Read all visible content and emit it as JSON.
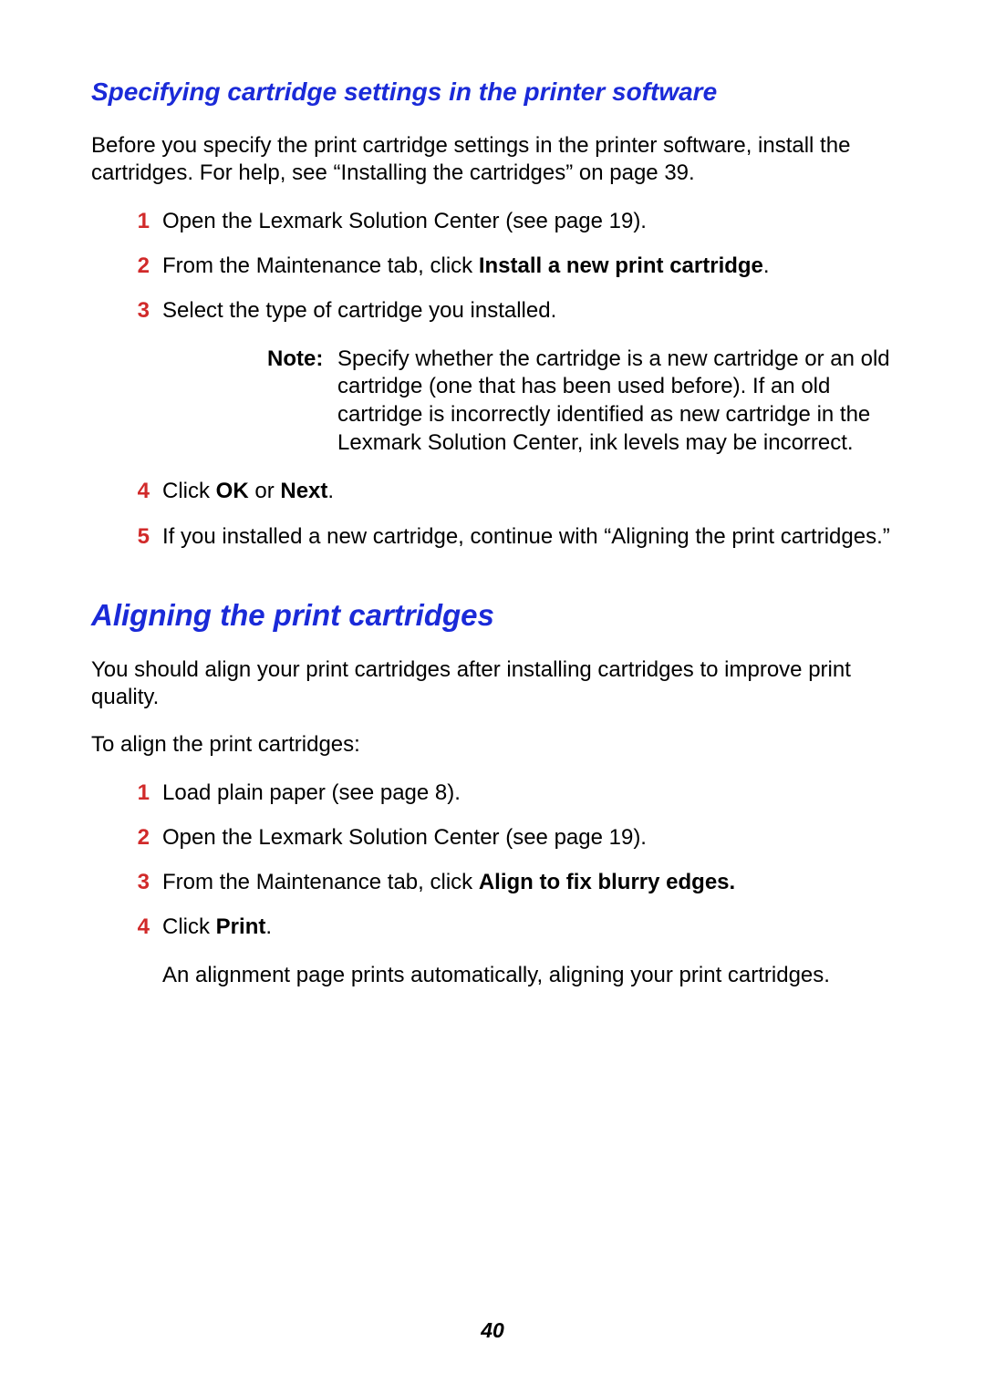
{
  "section1": {
    "heading": "Specifying cartridge settings in the printer software",
    "intro": "Before you specify the print cartridge settings in the printer software, install the cartridges. For help, see “Installing the cartridges” on page 39.",
    "steps": {
      "s1": "Open the Lexmark Solution Center (see page 19).",
      "s2_pre": "From the Maintenance tab, click ",
      "s2_b": "Install a new print cartridge",
      "s2_post": ".",
      "s3": "Select the type of cartridge you installed.",
      "note_label": "Note:",
      "note_body": "Specify whether the cartridge is a new cartridge or an old cartridge (one that has been used before). If an old cartridge is incorrectly identified as new cartridge in the Lexmark Solution Center, ink levels may be incorrect.",
      "s4_pre": "Click ",
      "s4_b1": "OK",
      "s4_mid": " or ",
      "s4_b2": "Next",
      "s4_post": ".",
      "s5": "If you installed a new cartridge, continue with “Aligning the print cartridges.”"
    }
  },
  "section2": {
    "heading": "Aligning the print cartridges",
    "intro": "You should align your print cartridges after installing cartridges to improve print quality.",
    "lead": "To align the print cartridges:",
    "steps": {
      "s1": "Load plain paper (see page 8).",
      "s2": "Open the Lexmark Solution Center (see page 19).",
      "s3_pre": "From the Maintenance tab, click ",
      "s3_b": "Align to fix blurry edges.",
      "s4_pre": "Click ",
      "s4_b": "Print",
      "s4_post": ".",
      "s4_tail": "An alignment page prints automatically, aligning your print cartridges."
    }
  },
  "page_number": "40"
}
